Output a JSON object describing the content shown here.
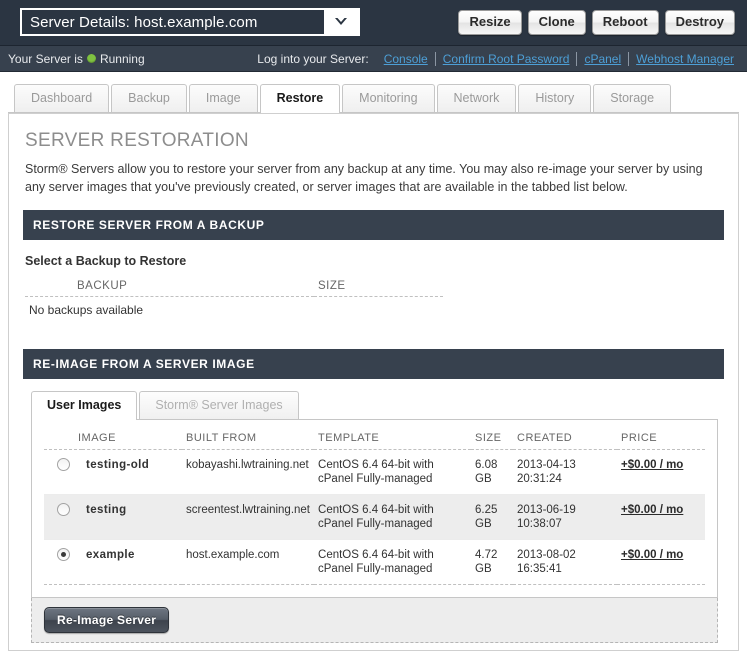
{
  "topbar": {
    "server_select_value": "Server Details: host.example.com",
    "dropdown_icon": "chevron-down-icon",
    "actions": [
      {
        "label": "Resize"
      },
      {
        "label": "Clone"
      },
      {
        "label": "Reboot"
      },
      {
        "label": "Destroy"
      }
    ]
  },
  "statusbar": {
    "prefix": "Your Server is",
    "state": "Running",
    "state_color": "#7fc241",
    "login_label": "Log into your Server:",
    "links": [
      "Console",
      "Confirm Root Password",
      "cPanel",
      "Webhost Manager"
    ],
    "link_color": "#4d9fd6"
  },
  "tabs": [
    {
      "label": "Dashboard",
      "active": false
    },
    {
      "label": "Backup",
      "active": false
    },
    {
      "label": "Image",
      "active": false
    },
    {
      "label": "Restore",
      "active": true
    },
    {
      "label": "Monitoring",
      "active": false
    },
    {
      "label": "Network",
      "active": false
    },
    {
      "label": "History",
      "active": false
    },
    {
      "label": "Storage",
      "active": false
    }
  ],
  "main": {
    "title": "SERVER RESTORATION",
    "intro": "Storm® Servers allow you to restore your server from any backup at any time. You may also re-image your server by using any server images that you've previously created, or server images that are available in the tabbed list below.",
    "backup_section": {
      "header": "RESTORE SERVER FROM A BACKUP",
      "subhead": "Select a Backup to Restore",
      "columns": [
        "BACKUP",
        "SIZE"
      ],
      "empty_message": "No backups available"
    },
    "reimage_section": {
      "header": "RE-IMAGE FROM A SERVER IMAGE",
      "tabs": [
        {
          "label": "User Images",
          "active": true
        },
        {
          "label": "Storm® Server Images",
          "active": false
        }
      ],
      "columns": [
        "IMAGE",
        "BUILT FROM",
        "TEMPLATE",
        "SIZE",
        "CREATED",
        "PRICE"
      ],
      "rows": [
        {
          "selected": false,
          "name": "testing-old",
          "built_from": "kobayashi.lwtraining.net",
          "template": "CentOS 6.4 64-bit with cPanel Fully-managed",
          "size": "6.08 GB",
          "created": "2013-04-13 20:31:24",
          "price": "+$0.00 / mo"
        },
        {
          "selected": false,
          "name": "testing",
          "built_from": "screentest.lwtraining.net",
          "template": "CentOS 6.4 64-bit with cPanel Fully-managed",
          "size": "6.25 GB",
          "created": "2013-06-19 10:38:07",
          "price": "+$0.00 / mo"
        },
        {
          "selected": true,
          "name": "example",
          "built_from": "host.example.com",
          "template": "CentOS 6.4 64-bit with cPanel Fully-managed",
          "size": "4.72 GB",
          "created": "2013-08-02 16:35:41",
          "price": "+$0.00 / mo"
        }
      ],
      "submit_label": "Re-Image Server"
    }
  }
}
